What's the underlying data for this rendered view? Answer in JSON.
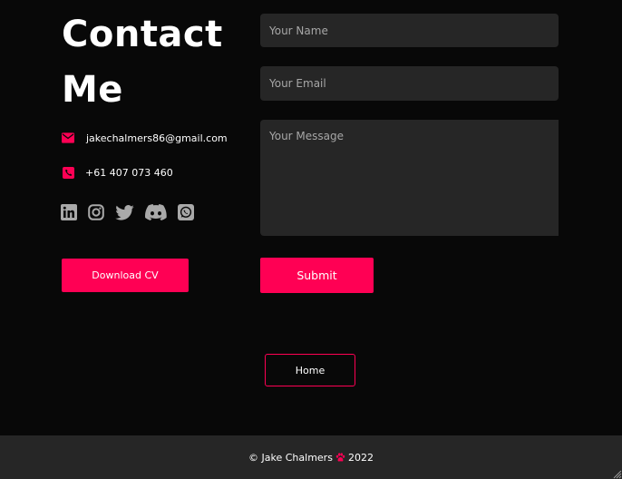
{
  "contact": {
    "title_line1": "Contact",
    "title_line2": "Me",
    "email": "jakechalmers86@gmail.com",
    "phone": "+61 407 073 460",
    "socials": [
      "linkedin-icon",
      "instagram-icon",
      "twitter-icon",
      "discord-icon",
      "whatsapp-icon"
    ],
    "download_cv_label": "Download CV"
  },
  "form": {
    "name_placeholder": "Your Name",
    "email_placeholder": "Your Email",
    "message_placeholder": "Your Message",
    "submit_label": "Submit"
  },
  "nav": {
    "home_label": "Home"
  },
  "footer": {
    "copyright": "© Jake Chalmers",
    "year": "2022"
  },
  "colors": {
    "background": "#080808",
    "accent": "#ff0054",
    "field_background": "#262626",
    "footer_background": "#262626",
    "icon_gray": "#a9a9a9"
  }
}
